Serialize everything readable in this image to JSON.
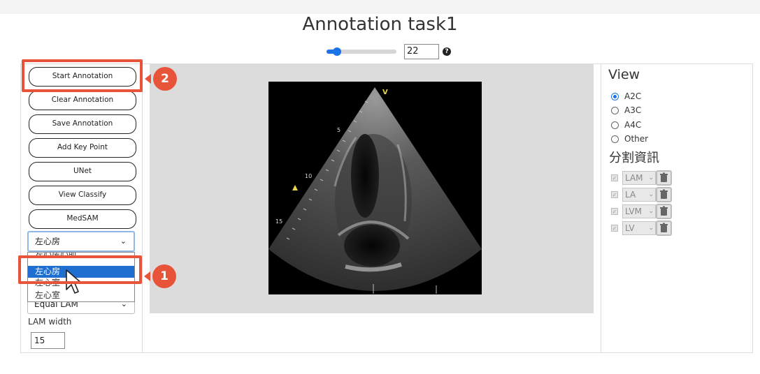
{
  "page": {
    "title": "Annotation task1"
  },
  "frame_control": {
    "value": "22",
    "slider_fraction": 0.15,
    "help_glyph": "?"
  },
  "toolbar": {
    "buttons": [
      {
        "label": "Start Annotation"
      },
      {
        "label": "Clear Annotation"
      },
      {
        "label": "Save Annotation"
      },
      {
        "label": "Add Key Point"
      },
      {
        "label": "UNet"
      },
      {
        "label": "View Classify"
      },
      {
        "label": "MedSAM"
      }
    ]
  },
  "structure_select": {
    "value": "左心房",
    "options": [
      "左心房心肌",
      "左心房",
      "左心室",
      "左心室"
    ],
    "selected_index": 1
  },
  "mode_select": {
    "value": "Equal LAM"
  },
  "lam_width": {
    "label": "LAM width",
    "value": "15"
  },
  "echo_image": {
    "depth_labels": [
      "5",
      "10",
      "15"
    ],
    "marker": "V"
  },
  "view_panel": {
    "title": "View",
    "options": [
      {
        "label": "A2C",
        "checked": true
      },
      {
        "label": "A3C",
        "checked": false
      },
      {
        "label": "A4C",
        "checked": false
      },
      {
        "label": "Other",
        "checked": false
      }
    ]
  },
  "segmentation_panel": {
    "title": "分割資訊",
    "items": [
      {
        "label": "LAM"
      },
      {
        "label": "LA"
      },
      {
        "label": "LVM"
      },
      {
        "label": "LV"
      }
    ]
  },
  "callouts": {
    "first": "1",
    "second": "2"
  },
  "colors": {
    "accent": "#1a73e8",
    "callout": "#e8543a",
    "selected_option": "#1f6fd1"
  }
}
